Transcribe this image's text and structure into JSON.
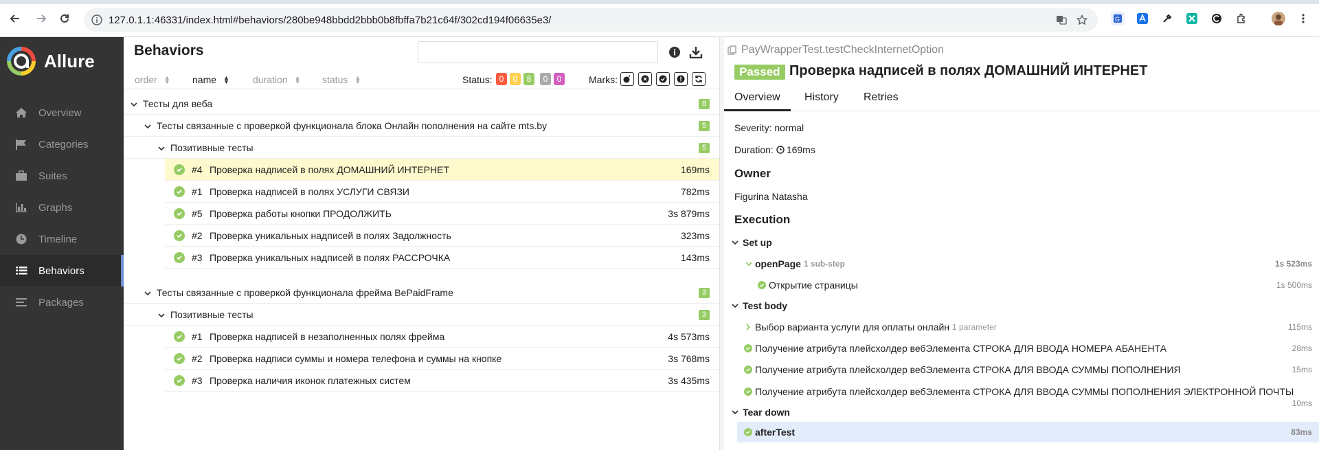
{
  "browser": {
    "url": "127.0.1.1:46331/index.html#behaviors/280be948bbdd2bbb0b8fbffa7b21c64f/302cd194f06635e3/"
  },
  "sidebar": {
    "brand": "Allure",
    "items": [
      {
        "label": "Overview",
        "icon": "home-icon"
      },
      {
        "label": "Categories",
        "icon": "flag-icon"
      },
      {
        "label": "Suites",
        "icon": "briefcase-icon"
      },
      {
        "label": "Graphs",
        "icon": "bar-chart-icon"
      },
      {
        "label": "Timeline",
        "icon": "clock-icon"
      },
      {
        "label": "Behaviors",
        "icon": "list-icon"
      },
      {
        "label": "Packages",
        "icon": "stack-icon"
      }
    ],
    "active": "Behaviors"
  },
  "behaviors": {
    "title": "Behaviors",
    "sort": {
      "order": "order",
      "name": "name",
      "duration": "duration",
      "status": "status"
    },
    "status_label": "Status:",
    "status_counts": [
      "0",
      "0",
      "8",
      "0",
      "0"
    ],
    "marks_label": "Marks:",
    "tree": {
      "root": {
        "label": "Тесты для веба",
        "count": "8"
      },
      "group1": {
        "label": "Тесты связанные с проверкой функционала блока Онлайн пополнения на сайте mts.by",
        "count": "5"
      },
      "group1_sub": {
        "label": "Позитивные тесты",
        "count": "5"
      },
      "group1_tests": [
        {
          "num": "#4",
          "name": "Проверка надписей в полях ДОМАШНИЙ ИНТЕРНЕТ",
          "dur": "169ms"
        },
        {
          "num": "#1",
          "name": "Проверка надписей в полях УСЛУГИ СВЯЗИ",
          "dur": "782ms"
        },
        {
          "num": "#5",
          "name": "Проверка работы кнопки ПРОДОЛЖИТЬ",
          "dur": "3s 879ms"
        },
        {
          "num": "#2",
          "name": "Проверка уникальных надписей в полях Задолжность",
          "dur": "323ms"
        },
        {
          "num": "#3",
          "name": "Проверка уникальных надписей в полях РАССРОЧКА",
          "dur": "143ms"
        }
      ],
      "group2": {
        "label": "Тесты связанные с проверкой функционала фрейма BePaidFrame",
        "count": "3"
      },
      "group2_sub": {
        "label": "Позитивные тесты",
        "count": "3"
      },
      "group2_tests": [
        {
          "num": "#1",
          "name": "Проверка надписей в незаполненных полях фрейма",
          "dur": "4s 573ms"
        },
        {
          "num": "#2",
          "name": "Проверка надписи суммы и номера телефона и суммы на кнопке",
          "dur": "3s 768ms"
        },
        {
          "num": "#3",
          "name": "Проверка наличия иконок платежных систем",
          "dur": "3s 435ms"
        }
      ]
    }
  },
  "detail": {
    "breadcrumb": "PayWrapperTest.testCheckInternetOption",
    "status": "Passed",
    "title": "Проверка надписей в полях ДОМАШНИЙ ИНТЕРНЕТ",
    "tabs": [
      "Overview",
      "History",
      "Retries"
    ],
    "severity": "Severity: normal",
    "duration_label": "Duration:",
    "duration": "169ms",
    "owner_heading": "Owner",
    "owner": "Figurina Natasha",
    "execution_heading": "Execution",
    "setup": {
      "label": "Set up",
      "step": {
        "name": "openPage",
        "meta": "1 sub-step",
        "dur": "1s 523ms"
      },
      "substep": {
        "name": "Открытие страницы",
        "dur": "1s 500ms"
      }
    },
    "body": {
      "label": "Test body",
      "steps": [
        {
          "name": "Выбор варианта услуги для оплаты онлайн",
          "meta": "1 parameter",
          "dur": "115ms"
        },
        {
          "name": "Получение атрибута плейсхолдер вебЭлемента СТРОКА ДЛЯ ВВОДА НОМЕРА АБАНЕНТА",
          "dur": "28ms"
        },
        {
          "name": "Получение атрибута плейсхолдер вебЭлемента СТРОКА ДЛЯ ВВОДА СУММЫ ПОПОЛНЕНИЯ",
          "dur": "15ms"
        },
        {
          "name": "Получение атрибута плейсхолдер вебЭлемента СТРОКА ДЛЯ ВВОДА СУММЫ ПОПОЛНЕНИЯ ЭЛЕКТРОННОЙ ПОЧТЫ",
          "dur": "10ms"
        }
      ]
    },
    "teardown": {
      "label": "Tear down",
      "step": {
        "name": "afterTest",
        "dur": "83ms"
      }
    }
  },
  "colors": {
    "passed": "#97cc64",
    "failed": "#fd5a3e",
    "broken": "#ffd050",
    "skipped": "#aaaaaa",
    "unknown": "#d35ebe",
    "sidebar": "#343434"
  }
}
